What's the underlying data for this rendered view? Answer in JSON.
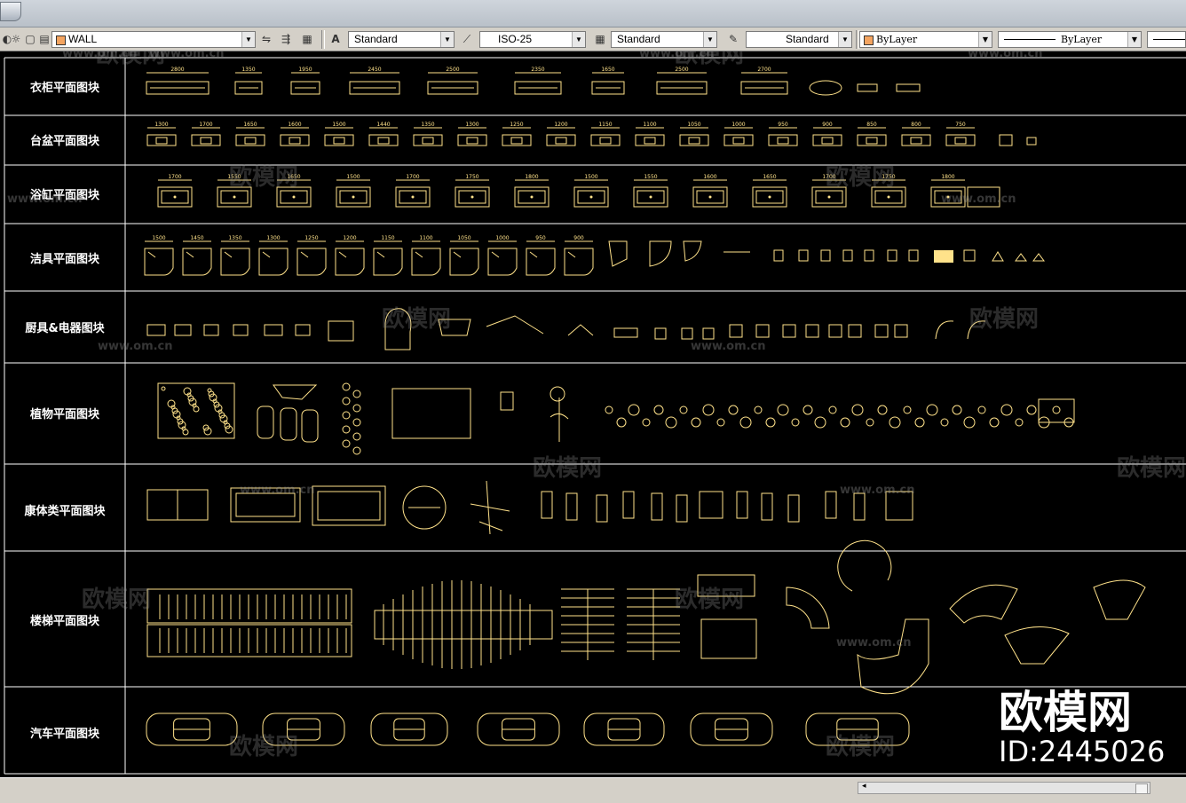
{
  "toolbar": {
    "layer_name": "WALL",
    "text_style": "Standard",
    "dim_style": "ISO-25",
    "table_style": "Standard",
    "multileader_style": "Standard",
    "color": "ByLayer",
    "linetype": "ByLayer"
  },
  "rows": [
    {
      "label": "衣柜平面图块"
    },
    {
      "label": "台盆平面图块"
    },
    {
      "label": "浴缸平面图块"
    },
    {
      "label": "洁具平面图块"
    },
    {
      "label": "厨具&电器图块"
    },
    {
      "label": "植物平面图块"
    },
    {
      "label": "康体类平面图块"
    },
    {
      "label": "楼梯平面图块"
    },
    {
      "label": "汽车平面图块"
    }
  ],
  "dims": {
    "row1": [
      "2800",
      "1350",
      "1950",
      "2450",
      "2500",
      "2350",
      "1650",
      "2500",
      "2700"
    ],
    "row2": [
      "1300",
      "1700",
      "1650",
      "1600",
      "1500",
      "1440",
      "1350",
      "1300",
      "1250",
      "1200",
      "1150",
      "1100",
      "1050",
      "1000",
      "950",
      "900",
      "850",
      "800",
      "750"
    ],
    "row3": [
      "1700",
      "1550",
      "1650",
      "1500",
      "1700",
      "1750",
      "1800",
      "1500",
      "1550",
      "1600",
      "1650",
      "1700",
      "1750",
      "1800"
    ],
    "row4": [
      "1500",
      "1450",
      "1350",
      "1300",
      "1250",
      "1200",
      "1150",
      "1100",
      "1050",
      "1000",
      "950",
      "900"
    ]
  },
  "watermark": {
    "brand": "欧模网",
    "url": "www.om.cn"
  },
  "brand_overlay": {
    "title": "欧模网",
    "id": "ID:2445026"
  }
}
